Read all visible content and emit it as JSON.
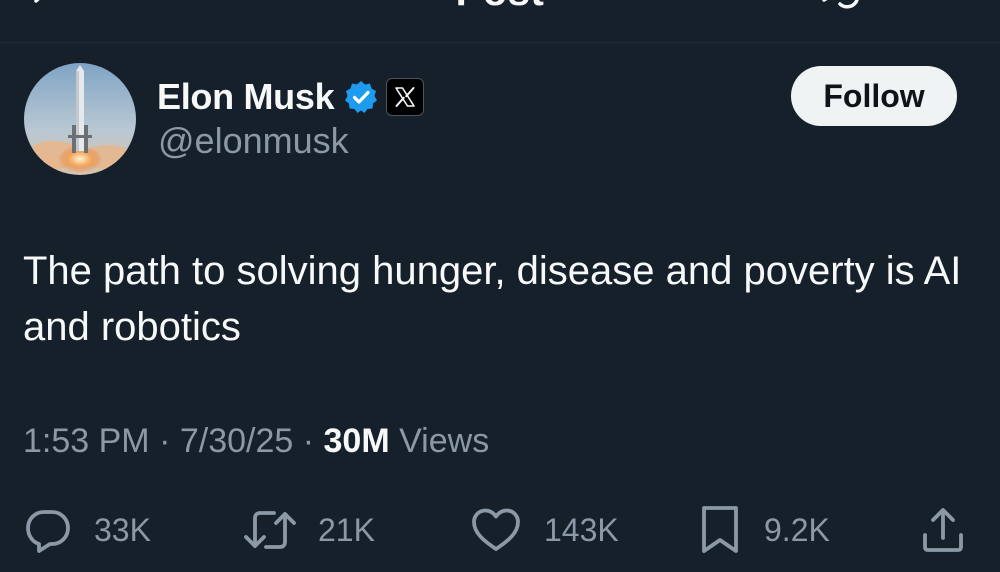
{
  "header": {
    "title": "Post"
  },
  "author": {
    "name": "Elon Musk",
    "handle": "@elonmusk"
  },
  "follow_label": "Follow",
  "tweet": {
    "text": "The path to solving hunger, disease and poverty is AI and robotics"
  },
  "meta": {
    "time": "1:53 PM",
    "date": "7/30/25",
    "separator": " · ",
    "views_count": "30M",
    "views_label": "Views"
  },
  "actions": {
    "replies": "33K",
    "reposts": "21K",
    "likes": "143K",
    "bookmarks": "9.2K"
  },
  "colors": {
    "background": "#15202b",
    "secondary_text": "#8b98a5",
    "verified_blue": "#1d9bf0"
  }
}
